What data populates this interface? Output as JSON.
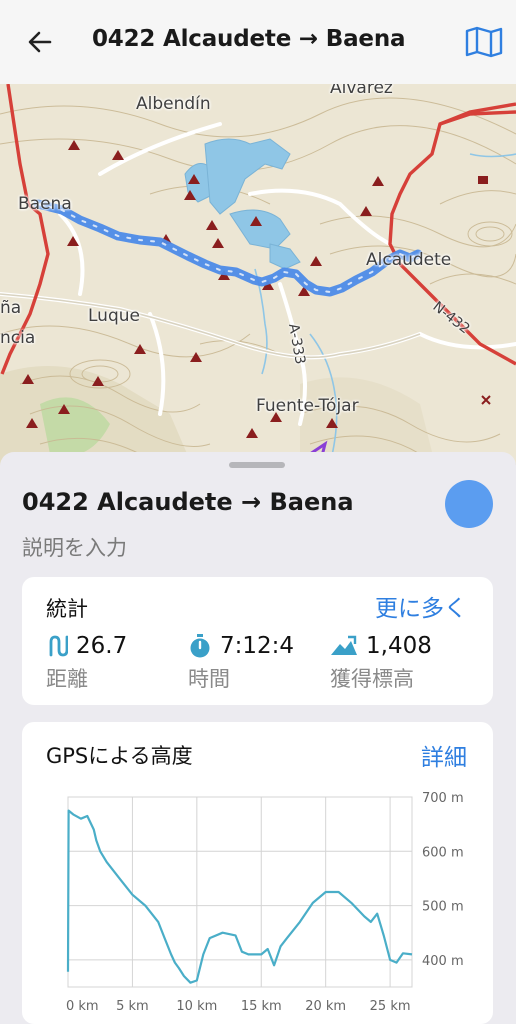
{
  "topbar": {
    "title": "0422 Alcaudete → Baena"
  },
  "map": {
    "labels": {
      "alvarez": "Álvarez",
      "albendin": "Albendín",
      "baena": "Baena",
      "alcaudete": "Alcaudete",
      "luque": "Luque",
      "fuente_tojar": "Fuente-Tójar",
      "ana": "ña",
      "ancia": "ncia",
      "n432": "N-432",
      "a333": "A-333"
    }
  },
  "sheet": {
    "title": "0422 Alcaudete → Baena",
    "description_placeholder": "説明を入力",
    "track_color": "#5b9df0"
  },
  "stats": {
    "heading": "統計",
    "more_link": "更に多く",
    "distance": {
      "value": "26.7",
      "label": "距離"
    },
    "time": {
      "value": "7:12:4",
      "label": "時間"
    },
    "ascent": {
      "value": "1,408",
      "label": "獲得標高"
    },
    "accent_color": "#3aa0c8"
  },
  "elevation": {
    "heading": "GPSによる高度",
    "detail_link": "詳細",
    "line_color": "#4aaec8"
  },
  "chart_data": {
    "type": "line",
    "xlabel": "",
    "ylabel": "",
    "xlim": [
      0,
      26.7
    ],
    "ylim": [
      350,
      700
    ],
    "x_ticks": [
      "0 km",
      "5 km",
      "10 km",
      "15 km",
      "20 km",
      "25 km"
    ],
    "x_tick_values": [
      0,
      5,
      10,
      15,
      20,
      25
    ],
    "y_ticks": [
      "400 m",
      "500 m",
      "600 m",
      "700 m"
    ],
    "y_tick_values": [
      400,
      500,
      600,
      700
    ],
    "series": [
      {
        "x": [
          0,
          0.05,
          0.4,
          1.0,
          1.5,
          2.0,
          2.2,
          2.5,
          3.0,
          4.0,
          5.0,
          6.0,
          7.0,
          7.5,
          8.0,
          8.3,
          8.6,
          9.0,
          9.5,
          10.0,
          10.5,
          11.0,
          12.0,
          13.0,
          13.5,
          14.0,
          15.0,
          15.5,
          16.0,
          16.5,
          17.0,
          18.0,
          19.0,
          20.0,
          21.0,
          22.0,
          23.0,
          23.5,
          24.0,
          24.5,
          25.0,
          25.5,
          26.0,
          26.7
        ],
        "y": [
          378,
          675,
          668,
          660,
          665,
          640,
          620,
          600,
          580,
          550,
          520,
          500,
          470,
          440,
          410,
          395,
          385,
          370,
          358,
          362,
          410,
          440,
          450,
          445,
          415,
          410,
          410,
          420,
          390,
          425,
          440,
          470,
          505,
          525,
          525,
          505,
          480,
          470,
          485,
          445,
          400,
          395,
          412,
          410
        ]
      }
    ],
    "grid": true
  }
}
